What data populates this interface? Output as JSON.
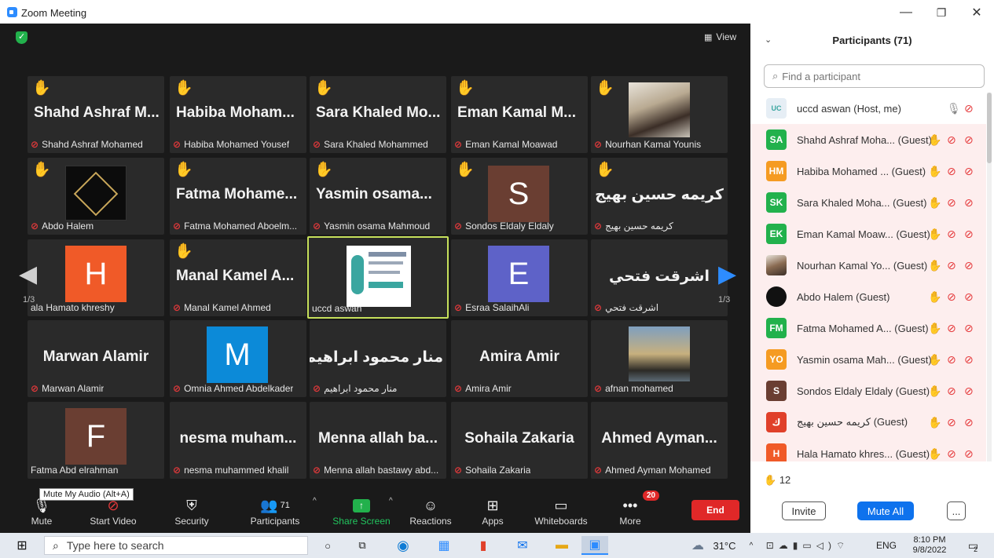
{
  "window": {
    "title": "Zoom Meeting"
  },
  "stage": {
    "view_label": "View",
    "page_left": "1/3",
    "page_right": "1/3",
    "tiles": [
      {
        "big": "Shahd Ashraf M...",
        "caption": "Shahd Ashraf Mohamed",
        "hand": true
      },
      {
        "big": "Habiba Moham...",
        "caption": "Habiba Mohamed Yousef",
        "hand": true
      },
      {
        "big": "Sara Khaled Mo...",
        "caption": "Sara Khaled Mohammed",
        "hand": true
      },
      {
        "big": "Eman Kamal M...",
        "caption": "Eman Kamal Moawad",
        "hand": true
      },
      {
        "big": "",
        "caption": "Nourhan Kamal Younis",
        "hand": true
      },
      {
        "big": "",
        "caption": "Abdo Halem",
        "hand": true
      },
      {
        "big": "Fatma Mohame...",
        "caption": "Fatma Mohamed Aboelm...",
        "hand": true
      },
      {
        "big": "Yasmin osama...",
        "caption": "Yasmin osama Mahmoud",
        "hand": true
      },
      {
        "big": "S",
        "caption": "Sondos Eldaly Eldaly",
        "hand": true
      },
      {
        "big": "كريمه حسين بهيج",
        "caption": "كريمه حسين بهيج",
        "hand": true
      },
      {
        "big": "H",
        "caption": "ala Hamato khreshy",
        "hand": false
      },
      {
        "big": "Manal Kamel A...",
        "caption": "Manal Kamel Ahmed",
        "hand": true
      },
      {
        "big": "",
        "caption": "uccd aswan",
        "hand": false
      },
      {
        "big": "E",
        "caption": "Esraa SalaihAli",
        "hand": false
      },
      {
        "big": "اشرقت فتحي",
        "caption": "اشرقت فتحي",
        "hand": false
      },
      {
        "big": "Marwan Alamir",
        "caption": "Marwan Alamir",
        "hand": false
      },
      {
        "big": "M",
        "caption": "Omnia Ahmed Abdelkader",
        "hand": false
      },
      {
        "big": "منار محمود ابراهيم",
        "caption": "منار محمود ابراهيم",
        "hand": false
      },
      {
        "big": "Amira Amir",
        "caption": "Amira Amir",
        "hand": false
      },
      {
        "big": "",
        "caption": "afnan mohamed",
        "hand": false
      },
      {
        "big": "F",
        "caption": "Fatma Abd elrahman",
        "hand": false
      },
      {
        "big": "nesma muham...",
        "caption": "nesma muhammed khalil",
        "hand": false
      },
      {
        "big": "Menna allah ba...",
        "caption": "Menna allah bastawy abd...",
        "hand": false
      },
      {
        "big": "Sohaila Zakaria",
        "caption": "Sohaila Zakaria",
        "hand": false
      },
      {
        "big": "Ahmed Ayman...",
        "caption": "Ahmed Ayman Mohamed",
        "hand": false
      }
    ]
  },
  "toolbar": {
    "tooltip": "Mute My Audio (Alt+A)",
    "mute": "Mute",
    "start_video": "Start Video",
    "security": "Security",
    "participants": "Participants",
    "participants_count": "71",
    "share_screen": "Share Screen",
    "reactions": "Reactions",
    "apps": "Apps",
    "whiteboards": "Whiteboards",
    "more": "More",
    "more_badge": "20",
    "end": "End"
  },
  "panel": {
    "title": "Participants (71)",
    "search_placeholder": "Find a participant",
    "participants": [
      {
        "initials": "",
        "name": "uccd aswan (Host, me)",
        "color": "#ffffff"
      },
      {
        "initials": "SA",
        "name": "Shahd Ashraf Moha... (Guest)",
        "color": "#22b14c"
      },
      {
        "initials": "HM",
        "name": "Habiba Mohamed ... (Guest)",
        "color": "#f59b22"
      },
      {
        "initials": "SK",
        "name": "Sara Khaled Moha... (Guest)",
        "color": "#22b14c"
      },
      {
        "initials": "EK",
        "name": "Eman Kamal Moaw... (Guest)",
        "color": "#22b14c"
      },
      {
        "initials": "",
        "name": "Nourhan Kamal Yo... (Guest)",
        "color": "#8a6b52"
      },
      {
        "initials": "",
        "name": "Abdo Halem (Guest)",
        "color": "#111111"
      },
      {
        "initials": "FM",
        "name": "Fatma Mohamed A... (Guest)",
        "color": "#22b14c"
      },
      {
        "initials": "YO",
        "name": "Yasmin osama Mah... (Guest)",
        "color": "#f59b22"
      },
      {
        "initials": "S",
        "name": "Sondos Eldaly Eldaly (Guest)",
        "color": "#6a3e32"
      },
      {
        "initials": "ك",
        "name": "كريمه حسين بهيج (Guest)",
        "color": "#e0402a"
      },
      {
        "initials": "H",
        "name": "Hala Hamato khres... (Guest)",
        "color": "#f05a28"
      }
    ],
    "hand_count": "12",
    "invite": "Invite",
    "mute_all": "Mute All",
    "more": "..."
  },
  "taskbar": {
    "search_placeholder": "Type here to search",
    "weather": "31°C",
    "lang": "ENG",
    "time": "8:10 PM",
    "date": "9/8/2022",
    "notif_count": "2"
  }
}
